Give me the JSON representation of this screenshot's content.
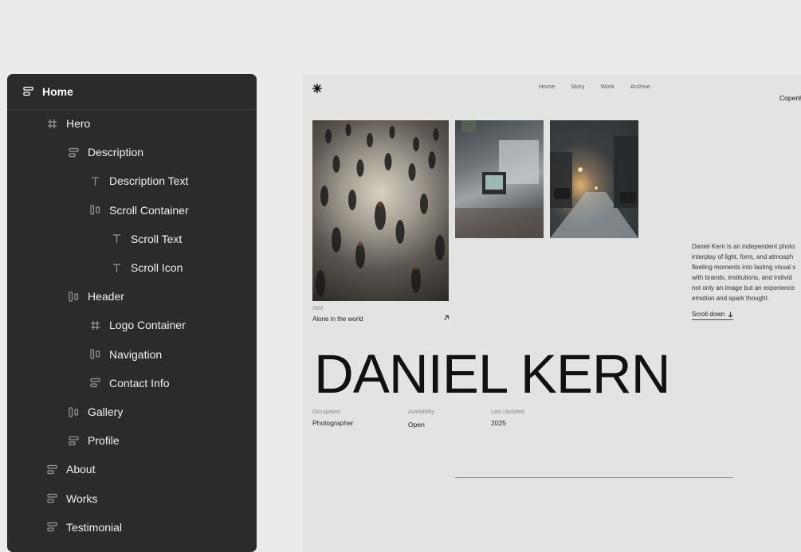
{
  "layers": {
    "root": {
      "label": "Home",
      "icon": "stack-icon"
    },
    "items": [
      {
        "label": "Hero",
        "icon": "frame-icon",
        "depth": 1
      },
      {
        "label": "Description",
        "icon": "stack-icon",
        "depth": 2
      },
      {
        "label": "Description Text",
        "icon": "text-icon",
        "depth": 3
      },
      {
        "label": "Scroll Container",
        "icon": "columns-icon",
        "depth": 3
      },
      {
        "label": "Scroll Text",
        "icon": "text-icon",
        "depth": 4
      },
      {
        "label": "Scroll Icon",
        "icon": "text-icon",
        "depth": 4
      },
      {
        "label": "Header",
        "icon": "columns-icon",
        "depth": 2
      },
      {
        "label": "Logo Container",
        "icon": "frame-icon",
        "depth": 3
      },
      {
        "label": "Navigation",
        "icon": "columns-icon",
        "depth": 3
      },
      {
        "label": "Contact Info",
        "icon": "stack-icon",
        "depth": 3
      },
      {
        "label": "Gallery",
        "icon": "columns-icon",
        "depth": 2
      },
      {
        "label": "Profile",
        "icon": "stack-icon",
        "depth": 2
      },
      {
        "label": "About",
        "icon": "stack-icon",
        "depth": 1
      },
      {
        "label": "Works",
        "icon": "stack-icon",
        "depth": 1
      },
      {
        "label": "Testimonial",
        "icon": "stack-icon",
        "depth": 1
      }
    ]
  },
  "site": {
    "nav": [
      "Home",
      "Story",
      "Work",
      "Archive"
    ],
    "location": "Copenh",
    "caption": {
      "number": "/002",
      "title": "Alone in the world"
    },
    "bio_lines": [
      "Daniel Kern is an independent photo",
      "interplay of light, form, and atmosph",
      "fleeting moments into lasting visual s",
      "with brands, institutions, and individ",
      "not only an image but an experience",
      "emotion and spark thought."
    ],
    "scroll_label": "Scroll down",
    "name": "DANIEL KERN",
    "meta": [
      {
        "key": "Occupation",
        "value": "Photographer"
      },
      {
        "key": "Availability",
        "value": "Open"
      },
      {
        "key": "Last Updated",
        "value": "2025"
      }
    ]
  },
  "colors": {
    "panel": "#2b2b2b",
    "page": "#ebebea",
    "site": "#e3e3e2"
  }
}
